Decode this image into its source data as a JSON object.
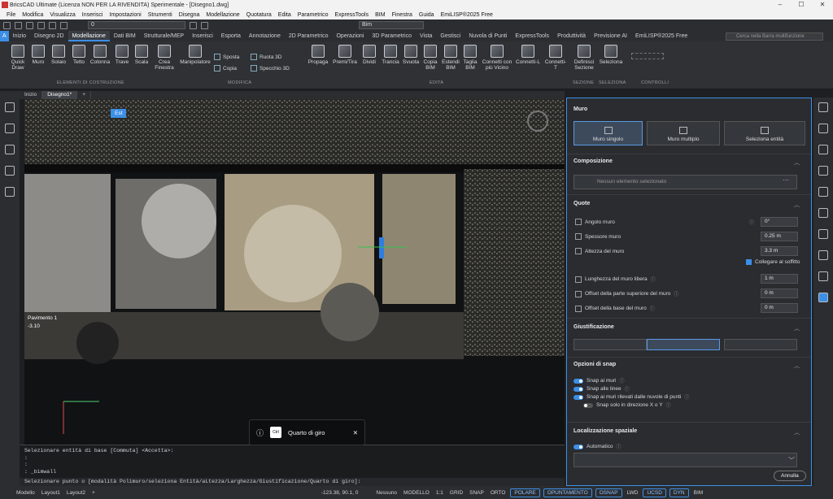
{
  "titlebar": {
    "title": "BricsCAD Ultimate (Licenza NON PER LA RIVENDITA) Sperimentale - [Disegno1.dwg]"
  },
  "menubar": {
    "items": [
      "File",
      "Modifica",
      "Visualizza",
      "Inserisci",
      "Impostazioni",
      "Strumenti",
      "Disegna",
      "Modellazione",
      "Quotatura",
      "Edita",
      "Parametrico",
      "ExpressTools",
      "BIM",
      "Finestra",
      "Guida",
      "EmiLISP®2025 Free"
    ]
  },
  "qat": {
    "layer_value": "0",
    "workspace_value": "Bim"
  },
  "ribbon": {
    "tabs": [
      "Inizio",
      "Disegno 2D",
      "Modellazione",
      "Dati BIM",
      "Strutturale/MEP",
      "Inserisci",
      "Esporta",
      "Annotazione",
      "2D Parametrico",
      "Operazioni",
      "3D Parametrico",
      "Vista",
      "Gestisci",
      "Nuvola di Punti",
      "ExpressTools",
      "Produttività",
      "Previsione AI",
      "EmiLISP®2025 Free"
    ],
    "active_tab": "Modellazione",
    "search_placeholder": "Cerca nella Barra multifunzione",
    "tools": [
      "Quick Draw",
      "Muro",
      "Solaio",
      "Tetto",
      "Colonna",
      "Trave",
      "Scala",
      "Crea Finestra",
      "Manipolatore",
      "Propaga",
      "Premi/Tira",
      "Dividi",
      "Trancia",
      "Svuota",
      "Copia BIM",
      "Estendi BIM",
      "Taglia BIM",
      "Connetti con più Vicino",
      "Connetti-L",
      "Connetti-T",
      "Definisci Sezione",
      "Seleziona"
    ],
    "small_tools": [
      "Sposta",
      "Ruota 3D",
      "Copia",
      "Specchio 3D"
    ],
    "groups": [
      "ELEMENTI DI COSTRUZIONE",
      "MODIFICA",
      "EDITA",
      "SEZIONE",
      "SELEZIONA",
      "CONTROLLI"
    ]
  },
  "doctabs": [
    "Inizio",
    "Disegno1*",
    "+"
  ],
  "viewport": {
    "view_label": "Est",
    "level_label": "Pavimento 1",
    "level_value": "-3.10"
  },
  "cmd": {
    "lines": [
      "Selezionare entità di base [Commuta] <Accetta>:",
      ":",
      ":",
      ": _bimwall"
    ],
    "prompt": "Selezionare punto o [modalità Polimuro/seleziona Entità/aLtezza/Larghezza/Giustificazione/Quarto di giro]:"
  },
  "tooltip": {
    "key": "Ctrl",
    "text": "Quarto di giro"
  },
  "status": {
    "left": [
      "Modello",
      "Layout1",
      "Layout2",
      "+"
    ],
    "coords": "-123.38, 90.1, 0",
    "items": [
      "Nessuno",
      "MODELLO",
      "1:1",
      "GRID",
      "SNAP",
      "ORTO",
      "POLARE",
      "OPUNTAMENTO",
      "OSNAP",
      "LWD",
      "UCSD",
      "DYN",
      "BIM"
    ]
  },
  "panel": {
    "title": "Muro",
    "modes": [
      "Muro singolo",
      "Muro multiplo",
      "Seleziona entità"
    ],
    "composizione": {
      "header": "Composizione",
      "field": "Nessun elemento selezionato"
    },
    "quote": {
      "header": "Quote",
      "rows": [
        {
          "label": "Angolo muro",
          "value": "0°"
        },
        {
          "label": "Spessore muro",
          "value": "0.25 m"
        },
        {
          "label": "Altezza del muro",
          "value": "3.3 m"
        }
      ],
      "collegare": "Collegare al soffitto",
      "rows2": [
        {
          "label": "Lunghezza del muro libera",
          "value": "1 m"
        },
        {
          "label": "Offset della parte superiore del muro",
          "value": "0 m"
        },
        {
          "label": "Offset della base del muro",
          "value": "0 m"
        }
      ]
    },
    "giustificazione": {
      "header": "Giustificazione"
    },
    "snap": {
      "header": "Opzioni di snap",
      "items": [
        "Snap ai muri",
        "Snap alle linee",
        "Snap ai muri rilevati dalle nuvole di punti",
        "Snap solo in direzione X o Y"
      ]
    },
    "localizzazione": {
      "header": "Localizzazione spaziale",
      "automatico": "Automatico"
    },
    "annulla": "Annulla"
  }
}
